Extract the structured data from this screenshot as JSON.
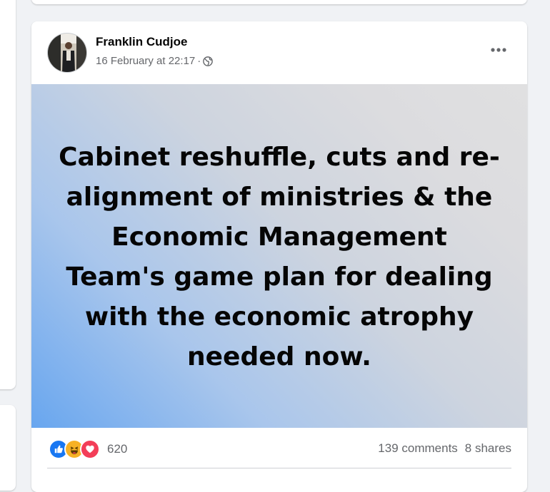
{
  "post": {
    "author": "Franklin Cudjoe",
    "date": "16 February at 22:17",
    "separator": "·",
    "privacy_icon": "globe-icon",
    "menu_icon": "more-options-icon",
    "banner_text": "Cabinet reshuffle, cuts and re-alignment of ministries & the Economic Management Team's game plan for dealing with the economic atrophy needed now.",
    "banner_gradient": [
      "#68a6ef",
      "#e0e0e1"
    ]
  },
  "stats": {
    "reaction_icons": [
      "like-icon",
      "haha-icon",
      "love-icon"
    ],
    "reaction_count": "620",
    "comments": "139 comments",
    "shares": "8 shares"
  },
  "colors": {
    "page_bg": "#f0f2f5",
    "like_blue": "#1877f2",
    "love_red": "#f33e58",
    "haha_yellow": "#f7b125",
    "secondary_text": "#65676b"
  }
}
